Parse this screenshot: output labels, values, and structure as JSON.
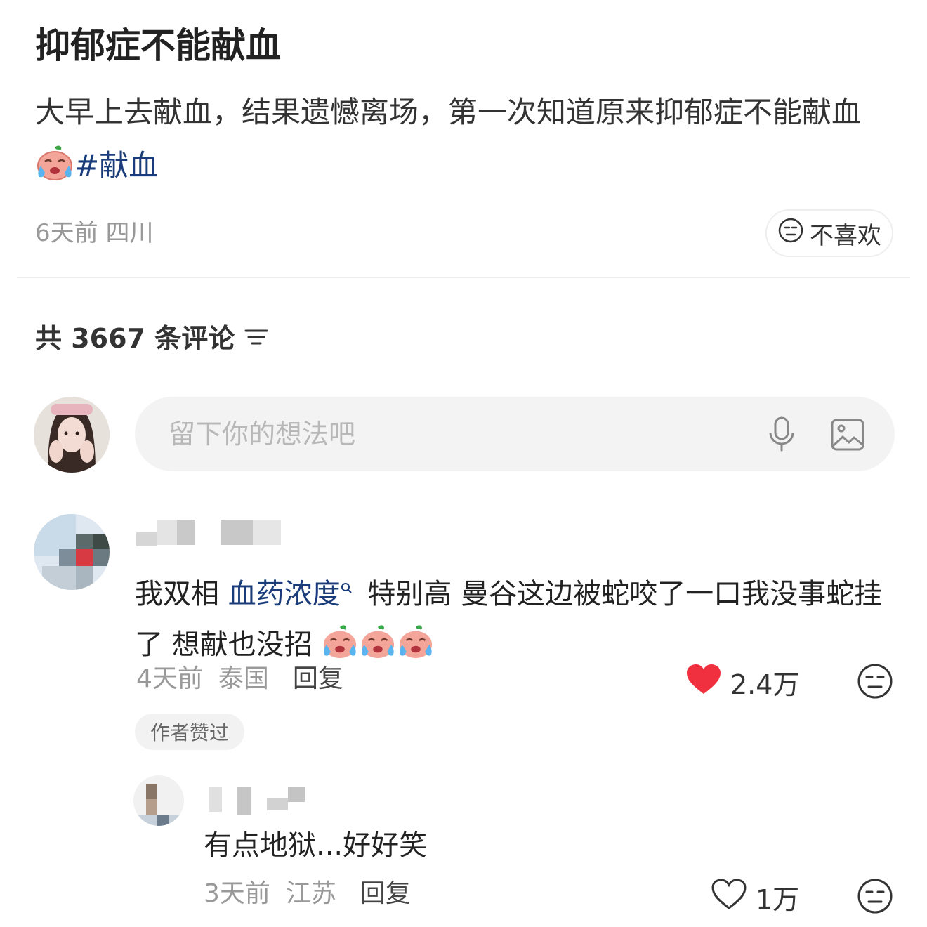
{
  "post": {
    "title": "抑郁症不能献血",
    "body": "大早上去献血，结果遗憾离场，第一次知道原来抑郁症不能献血",
    "hashtag": "#献血",
    "time": "6天前",
    "location": "四川",
    "dislike_label": "不喜欢"
  },
  "comments_header": {
    "label": "共 3667 条评论"
  },
  "comment_input": {
    "placeholder": "留下你的想法吧",
    "icons": [
      "microphone-icon",
      "image-icon"
    ]
  },
  "comments": [
    {
      "text_before": "我双相 ",
      "keyword": "血药浓度",
      "text_after": " 特别高 曼谷这边被蛇咬了一口我没事蛇挂了 想献也没招 ",
      "emoji_count": 3,
      "time": "4天前",
      "location": "泰国",
      "reply_label": "回复",
      "likes": "2.4万",
      "liked": true,
      "badge": "作者赞过"
    },
    {
      "text": "有点地狱...好好笑",
      "time": "3天前",
      "location": "江苏",
      "reply_label": "回复",
      "likes": "1万",
      "liked": false
    }
  ],
  "colors": {
    "hashtag": "#1a3c7a",
    "like_red": "#f0303e",
    "meta_gray": "#999999"
  }
}
